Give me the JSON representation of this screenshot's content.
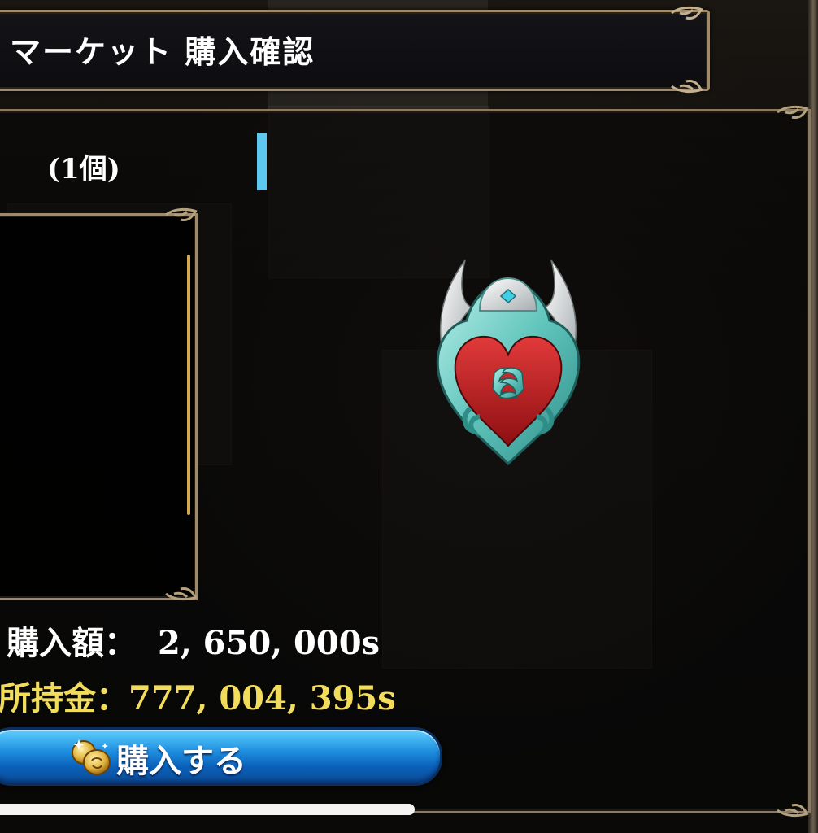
{
  "header": {
    "title": "マーケット 購入確認"
  },
  "item": {
    "quantity": "(1個)",
    "icon": "heart-shield-icon"
  },
  "price": {
    "label": "購入額：",
    "value": "2, 650, 000s"
  },
  "money": {
    "label": "所持金：",
    "value": "777, 004, 395s"
  },
  "buy_button": {
    "label": "購入する",
    "icon": "coin-icon"
  },
  "colors": {
    "accent_cyan": "#5ec8ef",
    "gold_text": "#f2dc5c",
    "button_blue": "#1f8fe0",
    "frame_gold": "#9c896e"
  },
  "scroll_progress": 0.5
}
